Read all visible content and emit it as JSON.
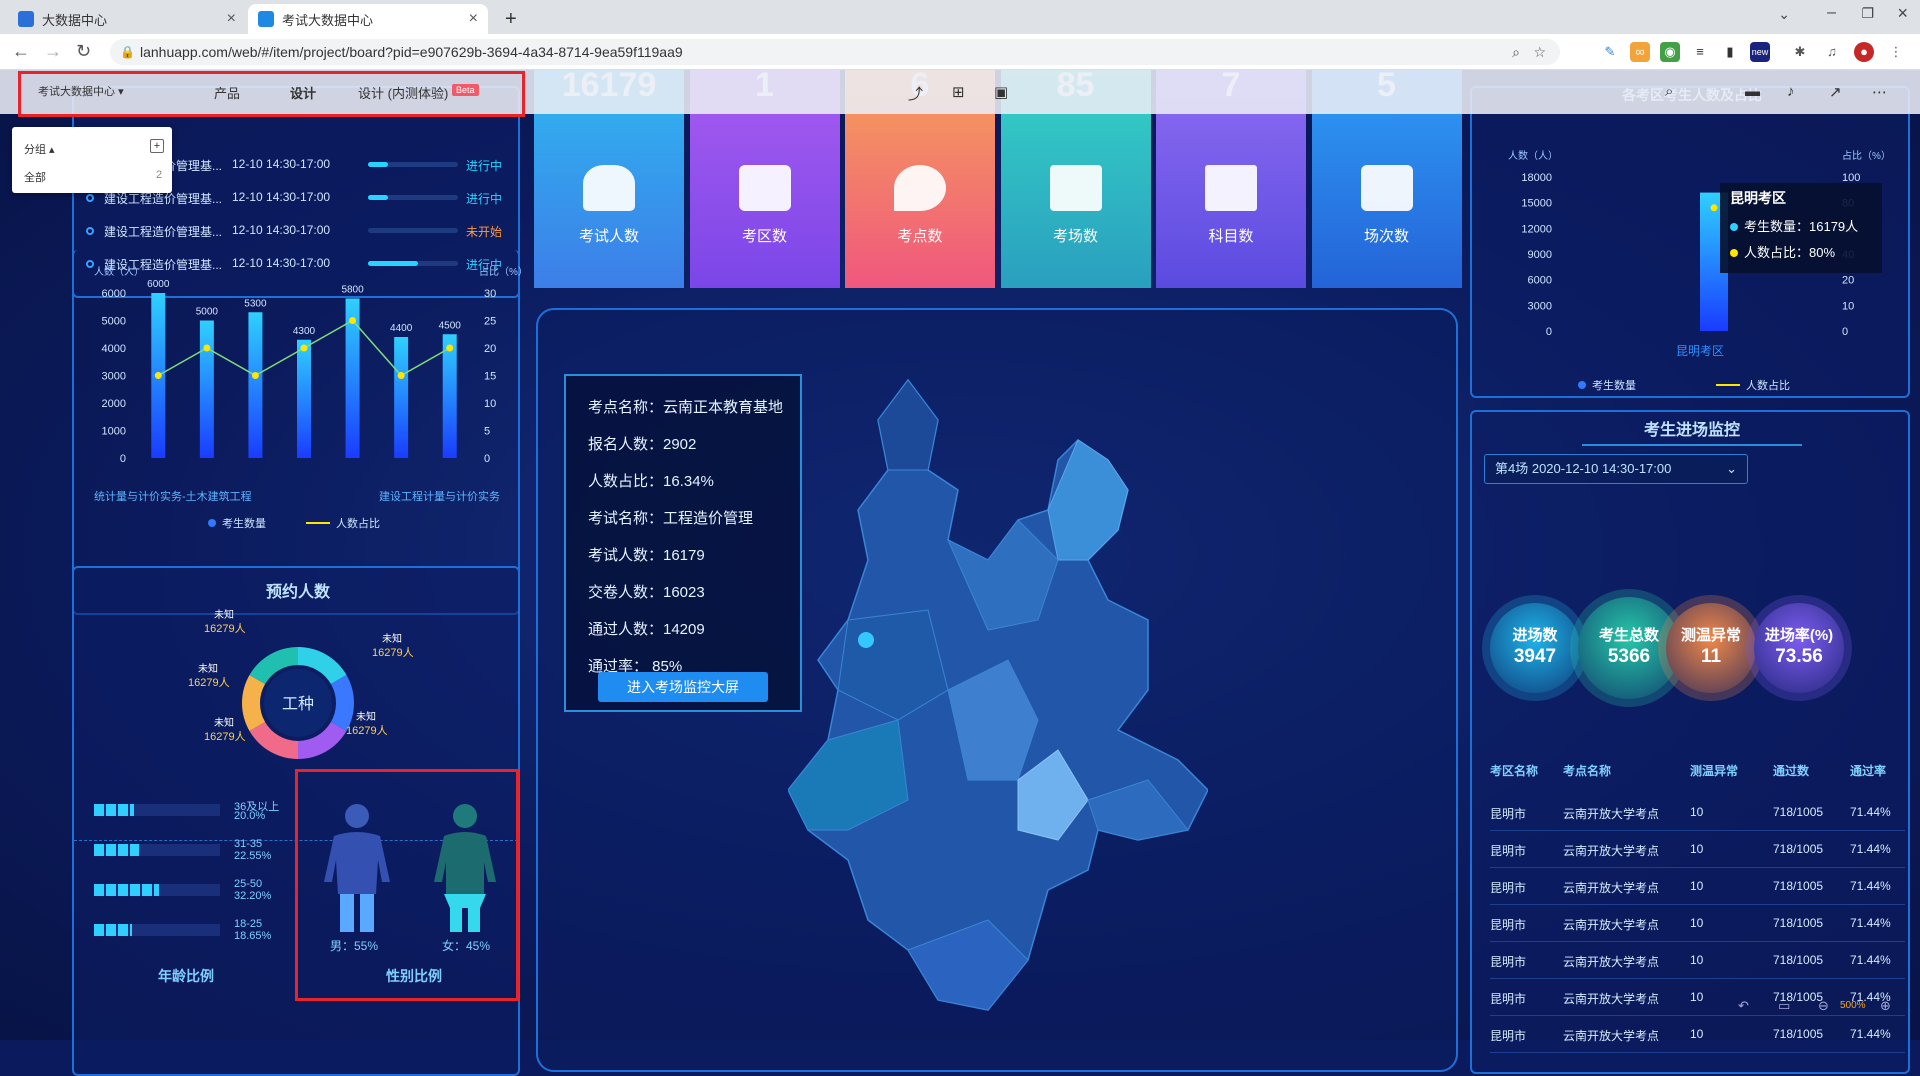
{
  "browser": {
    "tabs": [
      {
        "label": "大数据中心"
      },
      {
        "label": "考试大数据中心"
      }
    ],
    "url": "lanhuapp.com/web/#/item/project/board?pid=e907629b-3694-4a34-8714-9ea59f119aa9",
    "ext_new": "new"
  },
  "lanhu": {
    "project": "考试大数据中心",
    "nav": [
      "产品",
      "设计",
      "设计 (内测体验)"
    ],
    "beta": "Beta",
    "dropdown": {
      "group": "分组",
      "all": "全部",
      "count": "2"
    },
    "zoom": "500%"
  },
  "top_stats": [
    {
      "num": "16179",
      "label": "考试人数",
      "color1": "#2fb6f0",
      "color2": "#3d7ee8"
    },
    {
      "num": "1",
      "label": "考区数",
      "color1": "#a85cf0",
      "color2": "#7b46e8"
    },
    {
      "num": "6",
      "label": "考点数",
      "color1": "#f5a05a",
      "color2": "#f0577e"
    },
    {
      "num": "85",
      "label": "考场数",
      "color1": "#34d1c6",
      "color2": "#2a9fbf"
    },
    {
      "num": "7",
      "label": "科目数",
      "color1": "#8e6cf2",
      "color2": "#5a4be0"
    },
    {
      "num": "5",
      "label": "场次数",
      "color1": "#2f9cf5",
      "color2": "#2463d8"
    }
  ],
  "schedule": [
    {
      "name": "建设工程造价管理基...",
      "time": "12-10  14:30-17:00",
      "status": "进行中",
      "status_color": "#2fd3ff"
    },
    {
      "name": "建设工程造价管理基...",
      "time": "12-10  14:30-17:00",
      "status": "进行中",
      "status_color": "#2fd3ff"
    },
    {
      "name": "建设工程造价管理基...",
      "time": "12-10  14:30-17:00",
      "status": "未开始",
      "status_color": "#ff9a3c"
    },
    {
      "name": "建设工程造价管理基...",
      "time": "12-10  14:30-17:00",
      "status": "进行中",
      "status_color": "#2fd3ff"
    }
  ],
  "chart_data": [
    {
      "type": "bar",
      "ylabel": "人数（人）",
      "y2label": "占比（%）",
      "ylim": [
        0,
        6000
      ],
      "y2lim": [
        0,
        30
      ],
      "yticks": [
        "6000",
        "5000",
        "4000",
        "3000",
        "2000",
        "1000",
        "0"
      ],
      "y2ticks": [
        "30",
        "25",
        "20",
        "15",
        "10",
        "5",
        "0"
      ],
      "values": [
        6000,
        5000,
        5300,
        4300,
        5800,
        4400,
        4500
      ],
      "ratios": [
        15,
        20,
        15,
        20,
        25,
        15,
        20
      ],
      "xlabel_left": "统计量与计价实务-土木建筑工程",
      "xlabel_right": "建设工程计量与计价实务",
      "legend": [
        "考生数量",
        "人数占比"
      ]
    },
    {
      "type": "bar",
      "ylabel": "人数（人）",
      "y2label": "占比（%）",
      "ylim": [
        0,
        18000
      ],
      "y2lim": [
        0,
        100
      ],
      "yticks": [
        "18000",
        "15000",
        "12000",
        "9000",
        "6000",
        "3000",
        "0"
      ],
      "y2ticks": [
        "100",
        "80",
        "60",
        "40",
        "20",
        "10",
        "0"
      ],
      "categories": [
        "昆明考区"
      ],
      "values": [
        16179
      ],
      "ratios": [
        80
      ],
      "title": "各考区考生人数及占比",
      "tooltip": {
        "title": "昆明考区",
        "count": "考生数量：16179人",
        "ratio": "人数占比：80%"
      },
      "legend": [
        "考生数量",
        "人数占比"
      ]
    }
  ],
  "reserve": {
    "title": "预约人数",
    "center": "工种",
    "labels": [
      {
        "k": "未知",
        "v": "16279人"
      },
      {
        "k": "未知",
        "v": "16279人"
      },
      {
        "k": "未知",
        "v": "16279人"
      },
      {
        "k": "未知",
        "v": "16279人"
      },
      {
        "k": "未知",
        "v": "16279人"
      },
      {
        "k": "未知",
        "v": "16279人"
      }
    ]
  },
  "age": {
    "title": "年龄比例",
    "rows": [
      {
        "range": "36及以上",
        "pct": "20.0%",
        "fill": 0.2
      },
      {
        "range": "31-35",
        "pct": "22.55%",
        "fill": 0.2255
      },
      {
        "range": "25-50",
        "pct": "32.20%",
        "fill": 0.322
      },
      {
        "range": "18-25",
        "pct": "18.65%",
        "fill": 0.1865
      }
    ]
  },
  "gender": {
    "title": "性别比例",
    "male": "男：55%",
    "female": "女：45%"
  },
  "info": {
    "lines": [
      "考点名称：云南正本教育基地",
      "报名人数：2902",
      "人数占比：16.34%",
      "考试名称：工程造价管理",
      "考试人数：16179",
      "交卷人数：16023",
      "通过人数：14209",
      "通过率：  85%"
    ],
    "button": "进入考场监控大屏"
  },
  "monitor": {
    "title": "考生进场监控",
    "select": "第4场  2020-12-10  14:30-17:00",
    "bubbles": [
      {
        "label": "进场数",
        "value": "3947",
        "color": "#1fb4e8"
      },
      {
        "label": "考生总数",
        "value": "5366",
        "color": "#27c7a9"
      },
      {
        "label": "测温异常",
        "value": "11",
        "color": "#f0884a"
      },
      {
        "label": "进场率(%)",
        "value": "73.56",
        "color": "#7d5cf0"
      }
    ],
    "headers": [
      "考区名称",
      "考点名称",
      "测温异常",
      "通过数",
      "通过率"
    ],
    "rows": [
      [
        "昆明市",
        "云南开放大学考点",
        "10",
        "718/1005",
        "71.44%"
      ],
      [
        "昆明市",
        "云南开放大学考点",
        "10",
        "718/1005",
        "71.44%"
      ],
      [
        "昆明市",
        "云南开放大学考点",
        "10",
        "718/1005",
        "71.44%"
      ],
      [
        "昆明市",
        "云南开放大学考点",
        "10",
        "718/1005",
        "71.44%"
      ],
      [
        "昆明市",
        "云南开放大学考点",
        "10",
        "718/1005",
        "71.44%"
      ],
      [
        "昆明市",
        "云南开放大学考点",
        "10",
        "718/1005",
        "71.44%"
      ],
      [
        "昆明市",
        "云南开放大学考点",
        "10",
        "718/1005",
        "71.44%"
      ]
    ]
  }
}
